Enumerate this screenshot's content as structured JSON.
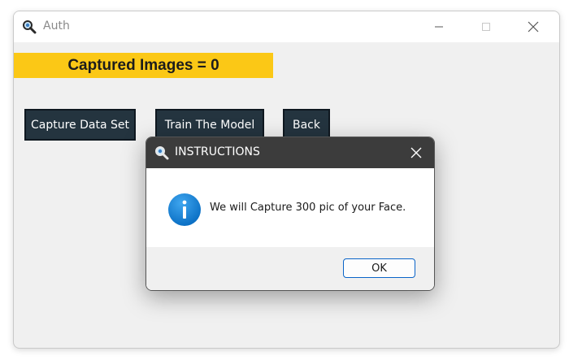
{
  "window": {
    "title": "Auth",
    "minimize_icon": "minimize-icon",
    "maximize_icon": "maximize-icon",
    "close_icon": "close-icon"
  },
  "banner": {
    "text": "Captured Images = 0",
    "color": "#fbc816"
  },
  "buttons": {
    "capture": "Capture Data Set",
    "train": "Train The Model",
    "back": "Back",
    "color": "#24343f"
  },
  "dialog": {
    "title": "INSTRUCTIONS",
    "icon": "info-icon",
    "message": "We will Capture 300 pic of your Face.",
    "ok_label": "OK"
  }
}
